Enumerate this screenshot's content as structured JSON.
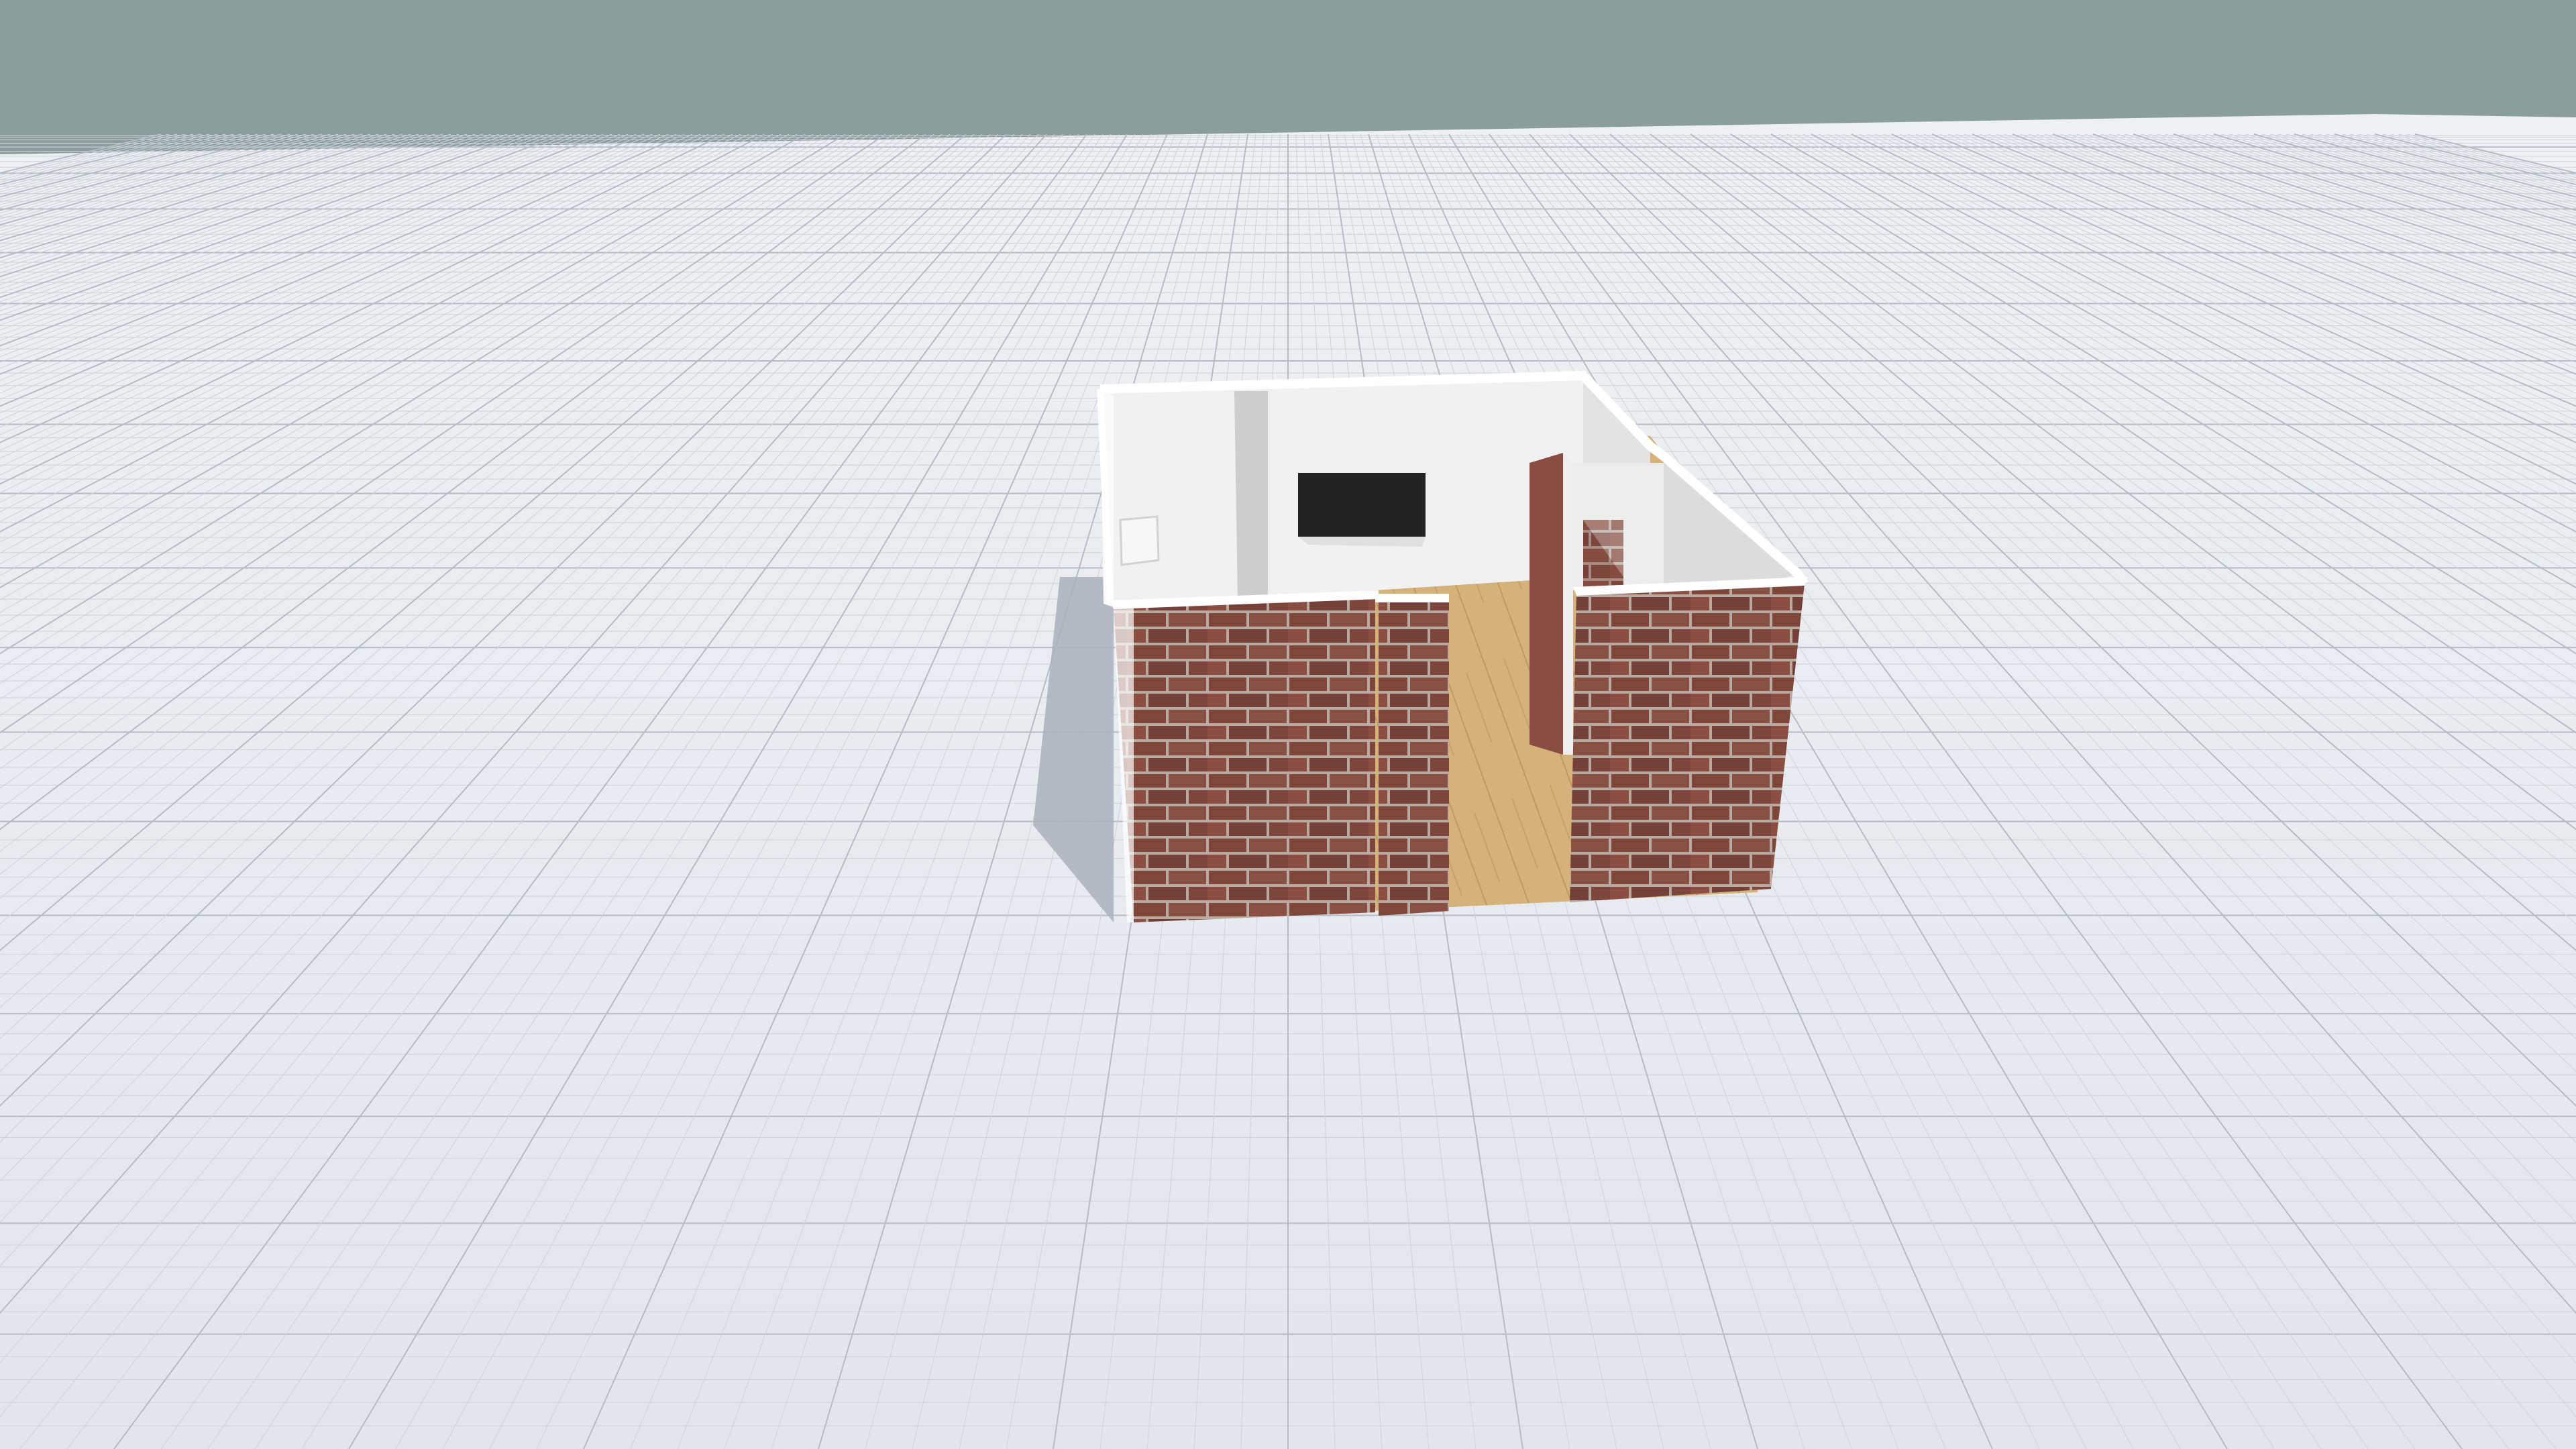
{
  "app": {
    "view": "3d-room-editor-viewport"
  },
  "colors": {
    "sky": "#8a9e9b",
    "ground": "#e9ecef",
    "grid_fine": "#cdd3da",
    "grid_major": "#b4bcc6",
    "brick_mortar": "#b9aaa0",
    "brick_base": "#80463b",
    "interior_wall": "#f2f2f2",
    "wall_top": "#ffffff",
    "wood_floor": "#d6b47c",
    "tv_screen": "#232323",
    "concrete_column": "#cfcfcf",
    "shadow": "#9ea7b3"
  },
  "scene": {
    "objects": [
      {
        "name": "room-walls",
        "material": "brick-exterior"
      },
      {
        "name": "interior-partition",
        "material": "painted-white"
      },
      {
        "name": "wall-mounted-tv",
        "type": "television"
      },
      {
        "name": "air-conditioner-unit",
        "type": "appliance"
      },
      {
        "name": "concrete-column",
        "material": "concrete"
      },
      {
        "name": "floor",
        "material": "wood"
      }
    ]
  }
}
